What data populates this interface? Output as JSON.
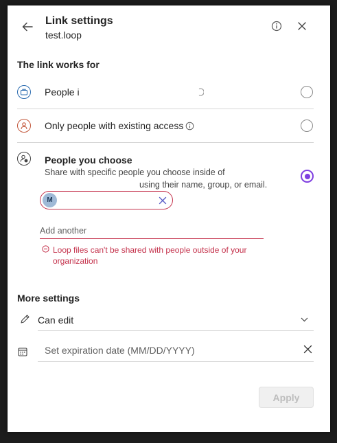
{
  "header": {
    "title": "Link settings",
    "filename": "test.loop",
    "back_icon": "arrow-left-icon",
    "info_icon": "info-icon",
    "close_icon": "close-icon"
  },
  "audience": {
    "heading": "The link works for",
    "options": [
      {
        "label": "People i",
        "icon": "briefcase-icon",
        "selected": false
      },
      {
        "label": "Only people with existing access",
        "icon": "person-icon",
        "selected": false
      },
      {
        "label": "People you choose",
        "description_line1": "Share with specific people you choose inside of",
        "description_line2": "using their name, group, or email.",
        "icon": "people-settings-icon",
        "selected": true
      }
    ]
  },
  "recipients": {
    "chip_avatar_initial": "M",
    "add_placeholder": "Add another",
    "error_line1": "Loop files can't be shared with people outside of your",
    "error_line2": "organization"
  },
  "more_settings": {
    "heading": "More settings",
    "permission": "Can edit",
    "expiration_placeholder": "Set expiration date (MM/DD/YYYY)"
  },
  "footer": {
    "apply_label": "Apply"
  },
  "colors": {
    "accent": "#7f3fe0",
    "error": "#c4314b",
    "org_icon": "#2b6cb0",
    "person_icon": "#c2563a"
  }
}
